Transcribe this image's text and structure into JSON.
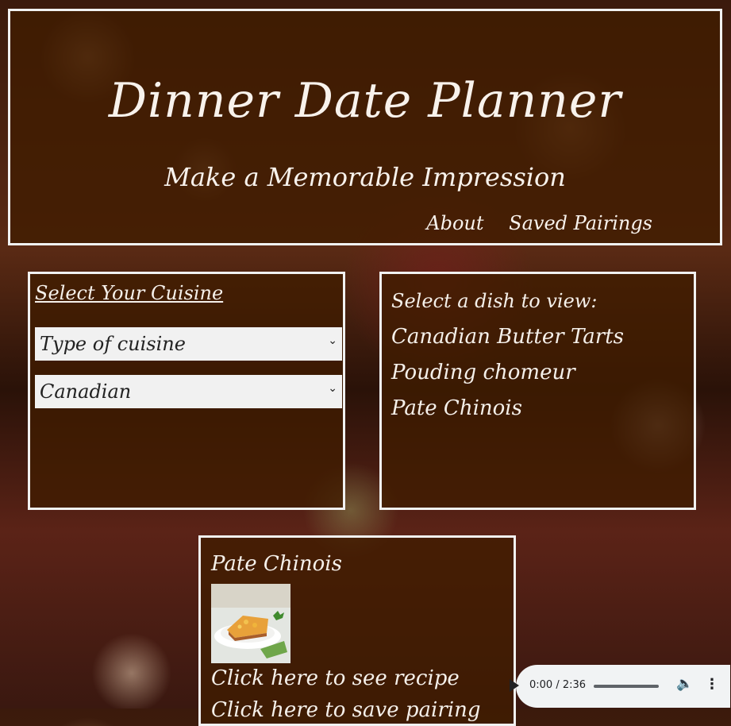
{
  "header": {
    "title": "Dinner Date Planner",
    "subtitle": "Make a Memorable Impression",
    "nav": {
      "about": "About",
      "saved_pairings": "Saved Pairings"
    }
  },
  "cuisine_panel": {
    "heading": "Select Your Cuisine",
    "type_select": {
      "selected": "Type of cuisine"
    },
    "cuisine_select": {
      "selected": "Canadian"
    }
  },
  "dish_panel": {
    "heading": "Select a dish to view:",
    "dishes": [
      "Canadian Butter Tarts",
      "Pouding chomeur",
      "Pate Chinois"
    ]
  },
  "recipe_panel": {
    "title": "Pate Chinois",
    "link_label": "Click here to see recipe",
    "second_link_label": "Click here to save pairing"
  },
  "audio_player": {
    "time": "0:00 / 2:36"
  },
  "colors": {
    "panel_bg": "#401c00",
    "border": "#f1f1f1",
    "text": "#f5f0ea"
  }
}
